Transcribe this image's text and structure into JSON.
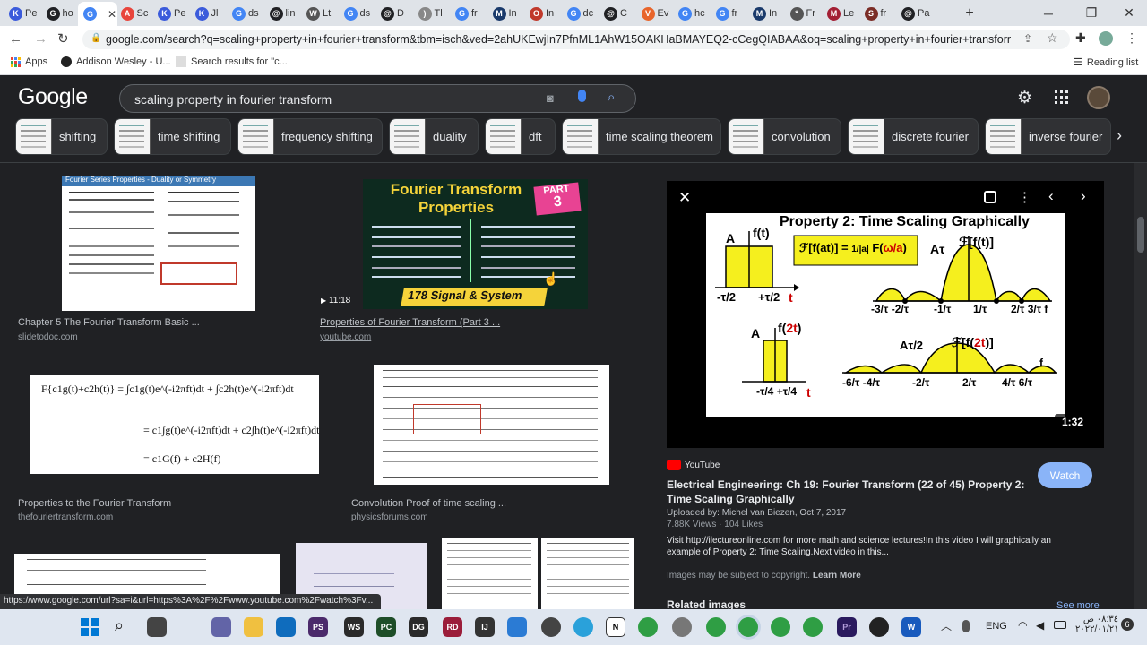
{
  "browser": {
    "tabs": [
      {
        "label": "Pe",
        "color": "#3b5bdb",
        "glyph": "K"
      },
      {
        "label": "ho",
        "color": "#202124",
        "glyph": "G"
      },
      {
        "label": "",
        "color": "#4285f4",
        "glyph": "G"
      },
      {
        "label": "Sc",
        "color": "#e8453c",
        "glyph": "A"
      },
      {
        "label": "Pe",
        "color": "#3b5bdb",
        "glyph": "K"
      },
      {
        "label": "Jl",
        "color": "#3b5bdb",
        "glyph": "K"
      },
      {
        "label": "ds",
        "color": "#4285f4",
        "glyph": "G"
      },
      {
        "label": "lin",
        "color": "#202124",
        "glyph": "@"
      },
      {
        "label": "Lt",
        "color": "#555555",
        "glyph": "W"
      },
      {
        "label": "ds",
        "color": "#4285f4",
        "glyph": "G"
      },
      {
        "label": "D",
        "color": "#202124",
        "glyph": "@"
      },
      {
        "label": "Tl",
        "color": "#888888",
        "glyph": ")"
      },
      {
        "label": "fr",
        "color": "#4285f4",
        "glyph": "G"
      },
      {
        "label": "In",
        "color": "#1a3a6b",
        "glyph": "M"
      },
      {
        "label": "In",
        "color": "#c0392b",
        "glyph": "O"
      },
      {
        "label": "dc",
        "color": "#4285f4",
        "glyph": "G"
      },
      {
        "label": "C",
        "color": "#202124",
        "glyph": "@"
      },
      {
        "label": "Ev",
        "color": "#e8652b",
        "glyph": "V"
      },
      {
        "label": "hc",
        "color": "#4285f4",
        "glyph": "G"
      },
      {
        "label": "fr",
        "color": "#4285f4",
        "glyph": "G"
      },
      {
        "label": "In",
        "color": "#1a3a6b",
        "glyph": "M"
      },
      {
        "label": "Fr",
        "color": "#555555",
        "glyph": "*"
      },
      {
        "label": "Le",
        "color": "#a31f34",
        "glyph": "M"
      },
      {
        "label": "fr",
        "color": "#7b2d26",
        "glyph": "S"
      },
      {
        "label": "Pa",
        "color": "#202124",
        "glyph": "@"
      }
    ],
    "new_tab": "+",
    "url": "google.com/search?q=scaling+property+in+fourier+transform&tbm=isch&ved=2ahUKEwjIn7PfnML1AhW15OAKHaBMAYEQ2-cCegQIABAA&oq=scaling+property+in+fourier+transform&gs_lcp...",
    "bookmarks": [
      {
        "label": "Apps"
      },
      {
        "label": "Addison Wesley - U..."
      },
      {
        "label": "Search results for \"c..."
      }
    ],
    "reading_list": "Reading list"
  },
  "google": {
    "logo": "Google",
    "query": "scaling property in fourier transform",
    "chips": [
      "shifting",
      "time shifting",
      "frequency shifting",
      "duality",
      "dft",
      "time scaling theorem",
      "convolution",
      "discrete fourier",
      "inverse fourier"
    ]
  },
  "results": [
    {
      "title": "Chapter 5 The Fourier Transform Basic ...",
      "site": "slidetodoc.com",
      "thumb_heading": "Fourier Series Properties - Duality or Symmetry"
    },
    {
      "title": "Properties of Fourier Transform (Part 3 ...",
      "site": "youtube.com",
      "thumb_heading": "Fourier Transform Properties",
      "thumb_part": "PART",
      "thumb_num": "3",
      "duration": "11:18",
      "thumb_banner": "178 Signal & System"
    },
    {
      "title": "Properties to the Fourier Transform",
      "site": "thefouriertransform.com",
      "formula1": "F{c1g(t)+c2h(t)} = ∫c1g(t)e^(-i2πft)dt + ∫c2h(t)e^(-i2πft)dt",
      "formula2": "= c1∫g(t)e^(-i2πft)dt + c2∫h(t)e^(-i2πft)dt",
      "formula3": "= c1G(f) + c2H(f)"
    },
    {
      "title": "Convolution Proof of time scaling ...",
      "site": "physicsforums.com"
    }
  ],
  "panel": {
    "source": "YouTube",
    "title_line1": "Electrical Engineering: Ch 19: Fourier Transform (22 of 45) Property 2:",
    "title_line2": "Time Scaling Graphically",
    "uploaded": "Uploaded by: Michel van Biezen, Oct 7, 2017",
    "views": "7.88K Views",
    "likes": "104 Likes",
    "desc_line1": "Visit http://ilectureonline.com for more math and science lectures!In this video I will graphically an",
    "desc_line2": "example of Property 2: Time Scaling.Next video in this...",
    "copyright": "Images may be subject to copyright.",
    "learn_more": "Learn More",
    "watch": "Watch",
    "duration": "1:32",
    "related": "Related images",
    "see_more": "See more",
    "slide_title": "Property 2: Time Scaling Graphically"
  },
  "status_url": "https://www.google.com/url?sa=i&url=https%3A%2F%2Fwww.youtube.com%2Fwatch%3Fv...",
  "taskbar": {
    "lang": "ENG",
    "time": "٠٨:٣٤ ص",
    "date": "٢٠٢٢/٠١/٢١",
    "notif": "6"
  }
}
